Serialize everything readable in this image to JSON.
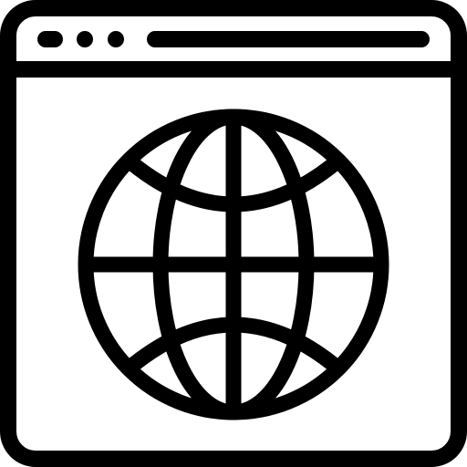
{
  "icon": {
    "name": "web-browser-globe-icon",
    "stroke_color": "#000000",
    "fill_color": "#ffffff"
  },
  "window": {
    "controls": [
      {
        "name": "window-control-dot-1"
      },
      {
        "name": "window-control-dot-2"
      },
      {
        "name": "window-control-dot-3"
      }
    ],
    "address_bar": {
      "name": "address-bar"
    }
  },
  "content": {
    "globe": {
      "name": "globe-icon"
    }
  }
}
